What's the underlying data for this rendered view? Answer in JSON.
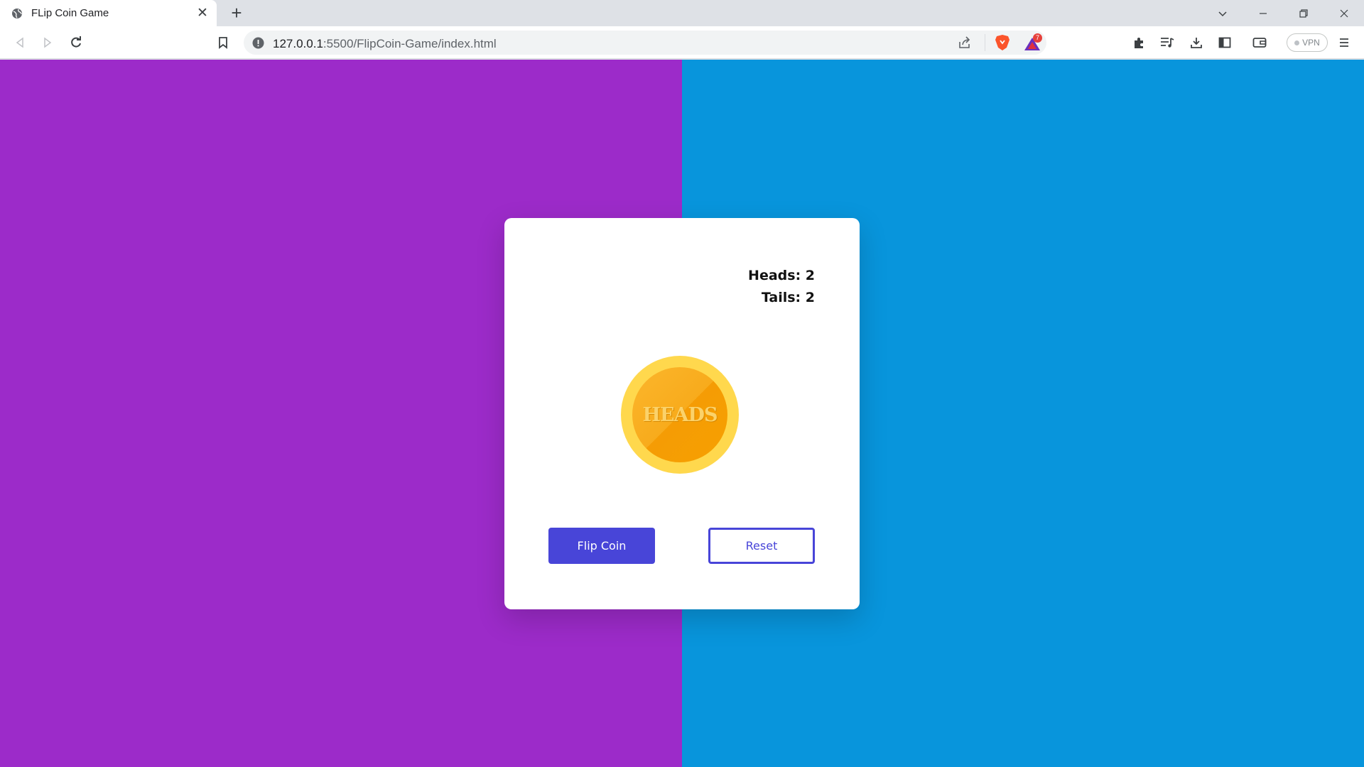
{
  "browser": {
    "tab_title": "FLip Coin Game",
    "tab_close_glyph": "✕",
    "new_tab_glyph": "+",
    "url_host": "127.0.0.1",
    "url_rest": ":5500/FlipCoin-Game/index.html",
    "vpn_label": "VPN",
    "notification_count": "7",
    "icons": [
      "globe-icon",
      "back-icon",
      "forward-icon",
      "reload-icon",
      "bookmark-icon",
      "site-info-icon",
      "share-icon",
      "brave-shields-icon",
      "brave-rewards-icon",
      "extensions-icon",
      "media-icon",
      "downloads-icon",
      "sidebar-icon",
      "wallet-icon",
      "menu-icon"
    ]
  },
  "colors": {
    "left_background": "#9c2bc9",
    "right_background": "#0895dc",
    "button_primary": "#4845d8",
    "coin_rim": "#ffd84d",
    "coin_face": "#f8ab1c"
  },
  "game": {
    "heads_label": "Heads: 2",
    "tails_label": "Tails: 2",
    "coin_face_text": "HEADS",
    "flip_button": "Flip Coin",
    "reset_button": "Reset"
  }
}
